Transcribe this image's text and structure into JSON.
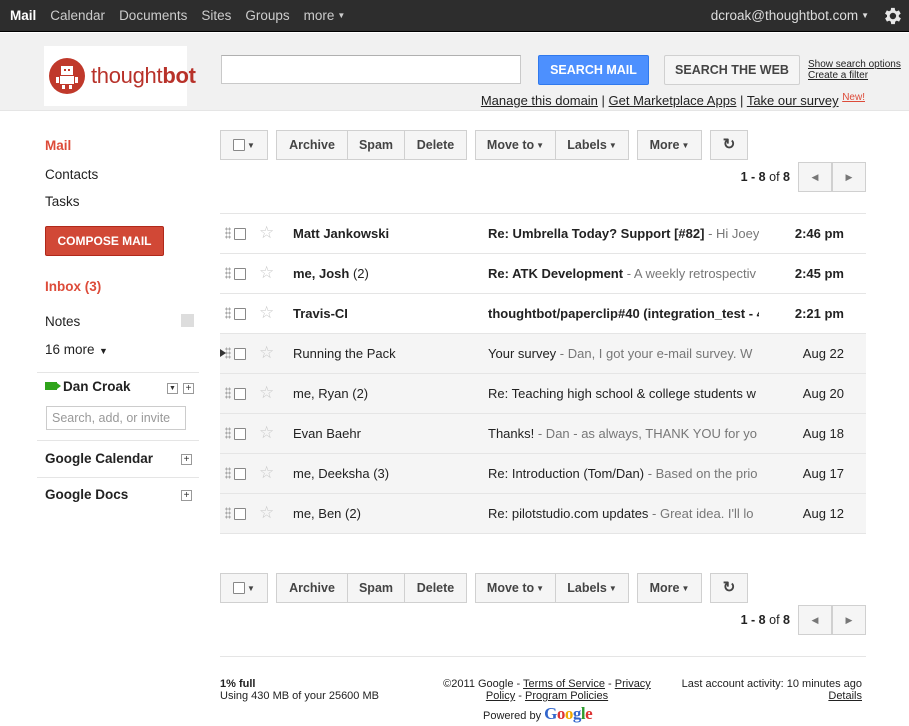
{
  "topnav": {
    "items": [
      "Mail",
      "Calendar",
      "Documents",
      "Sites",
      "Groups",
      "more"
    ],
    "user_email": "dcroak@thoughtbot.com"
  },
  "header": {
    "logo_text_light": "thought",
    "logo_text_bold": "bot",
    "search_placeholder": "",
    "search_mail_label": "SEARCH MAIL",
    "search_web_label": "SEARCH THE WEB",
    "show_search_options": "Show search options",
    "create_filter": "Create a filter",
    "links": [
      "Manage this domain",
      "Get Marketplace Apps",
      "Take our survey"
    ],
    "new_badge": "New!"
  },
  "sidebar": {
    "mail": "Mail",
    "contacts": "Contacts",
    "tasks": "Tasks",
    "compose": "COMPOSE MAIL",
    "inbox": "Inbox (3)",
    "notes": "Notes",
    "more": "16 more",
    "chat_user": "Dan Croak",
    "chat_search_placeholder": "Search, add, or invite",
    "gadget_calendar": "Google Calendar",
    "gadget_docs": "Google Docs"
  },
  "toolbar": {
    "archive": "Archive",
    "spam": "Spam",
    "delete": "Delete",
    "move_to": "Move to",
    "labels": "Labels",
    "more": "More"
  },
  "pager": {
    "range": "1 - 8",
    "of": "of",
    "total": "8"
  },
  "messages": [
    {
      "sender": "Matt Jankowski",
      "count": "",
      "subject": "Re: Umbrella Today? Support [#82]",
      "snippet": " - Hi Joey",
      "date": "2:46 pm",
      "unread": true
    },
    {
      "sender": "me, Josh",
      "count": " (2)",
      "subject": "Re: ATK Development",
      "snippet": " - A weekly retrospectiv",
      "date": "2:45 pm",
      "unread": true
    },
    {
      "sender": "Travis-CI",
      "count": "",
      "subject": "thoughtbot/paperclip#40 (integration_test - 4",
      "snippet": "",
      "date": "2:21 pm",
      "unread": true
    },
    {
      "sender": "Running the Pack",
      "count": "",
      "subject": "Your survey",
      "snippet": " - Dan, I got your e-mail survey. W",
      "date": "Aug 22",
      "unread": false
    },
    {
      "sender": "me, Ryan",
      "count": " (2)",
      "subject": "Re: Teaching high school & college students w",
      "snippet": "",
      "date": "Aug 20",
      "unread": false
    },
    {
      "sender": "Evan Baehr",
      "count": "",
      "subject": "Thanks!",
      "snippet": " - Dan - as always, THANK YOU for yo",
      "date": "Aug 18",
      "unread": false
    },
    {
      "sender": "me, Deeksha",
      "count": " (3)",
      "subject": "Re: Introduction (Tom/Dan)",
      "snippet": " - Based on the prio",
      "date": "Aug 17",
      "unread": false
    },
    {
      "sender": "me, Ben",
      "count": " (2)",
      "subject": "Re: pilotstudio.com updates",
      "snippet": " - Great idea. I'll lo",
      "date": "Aug 12",
      "unread": false
    }
  ],
  "footer": {
    "quota_percent": "1% full",
    "quota_usage": "Using 430 MB of your 25600 MB",
    "copyright": "©2011 Google",
    "terms": "Terms of Service",
    "privacy": "Privacy Policy",
    "program": "Program Policies",
    "powered_by": "Powered by",
    "google": "Google",
    "last_activity": "Last account activity: 10 minutes ago",
    "details": "Details"
  }
}
